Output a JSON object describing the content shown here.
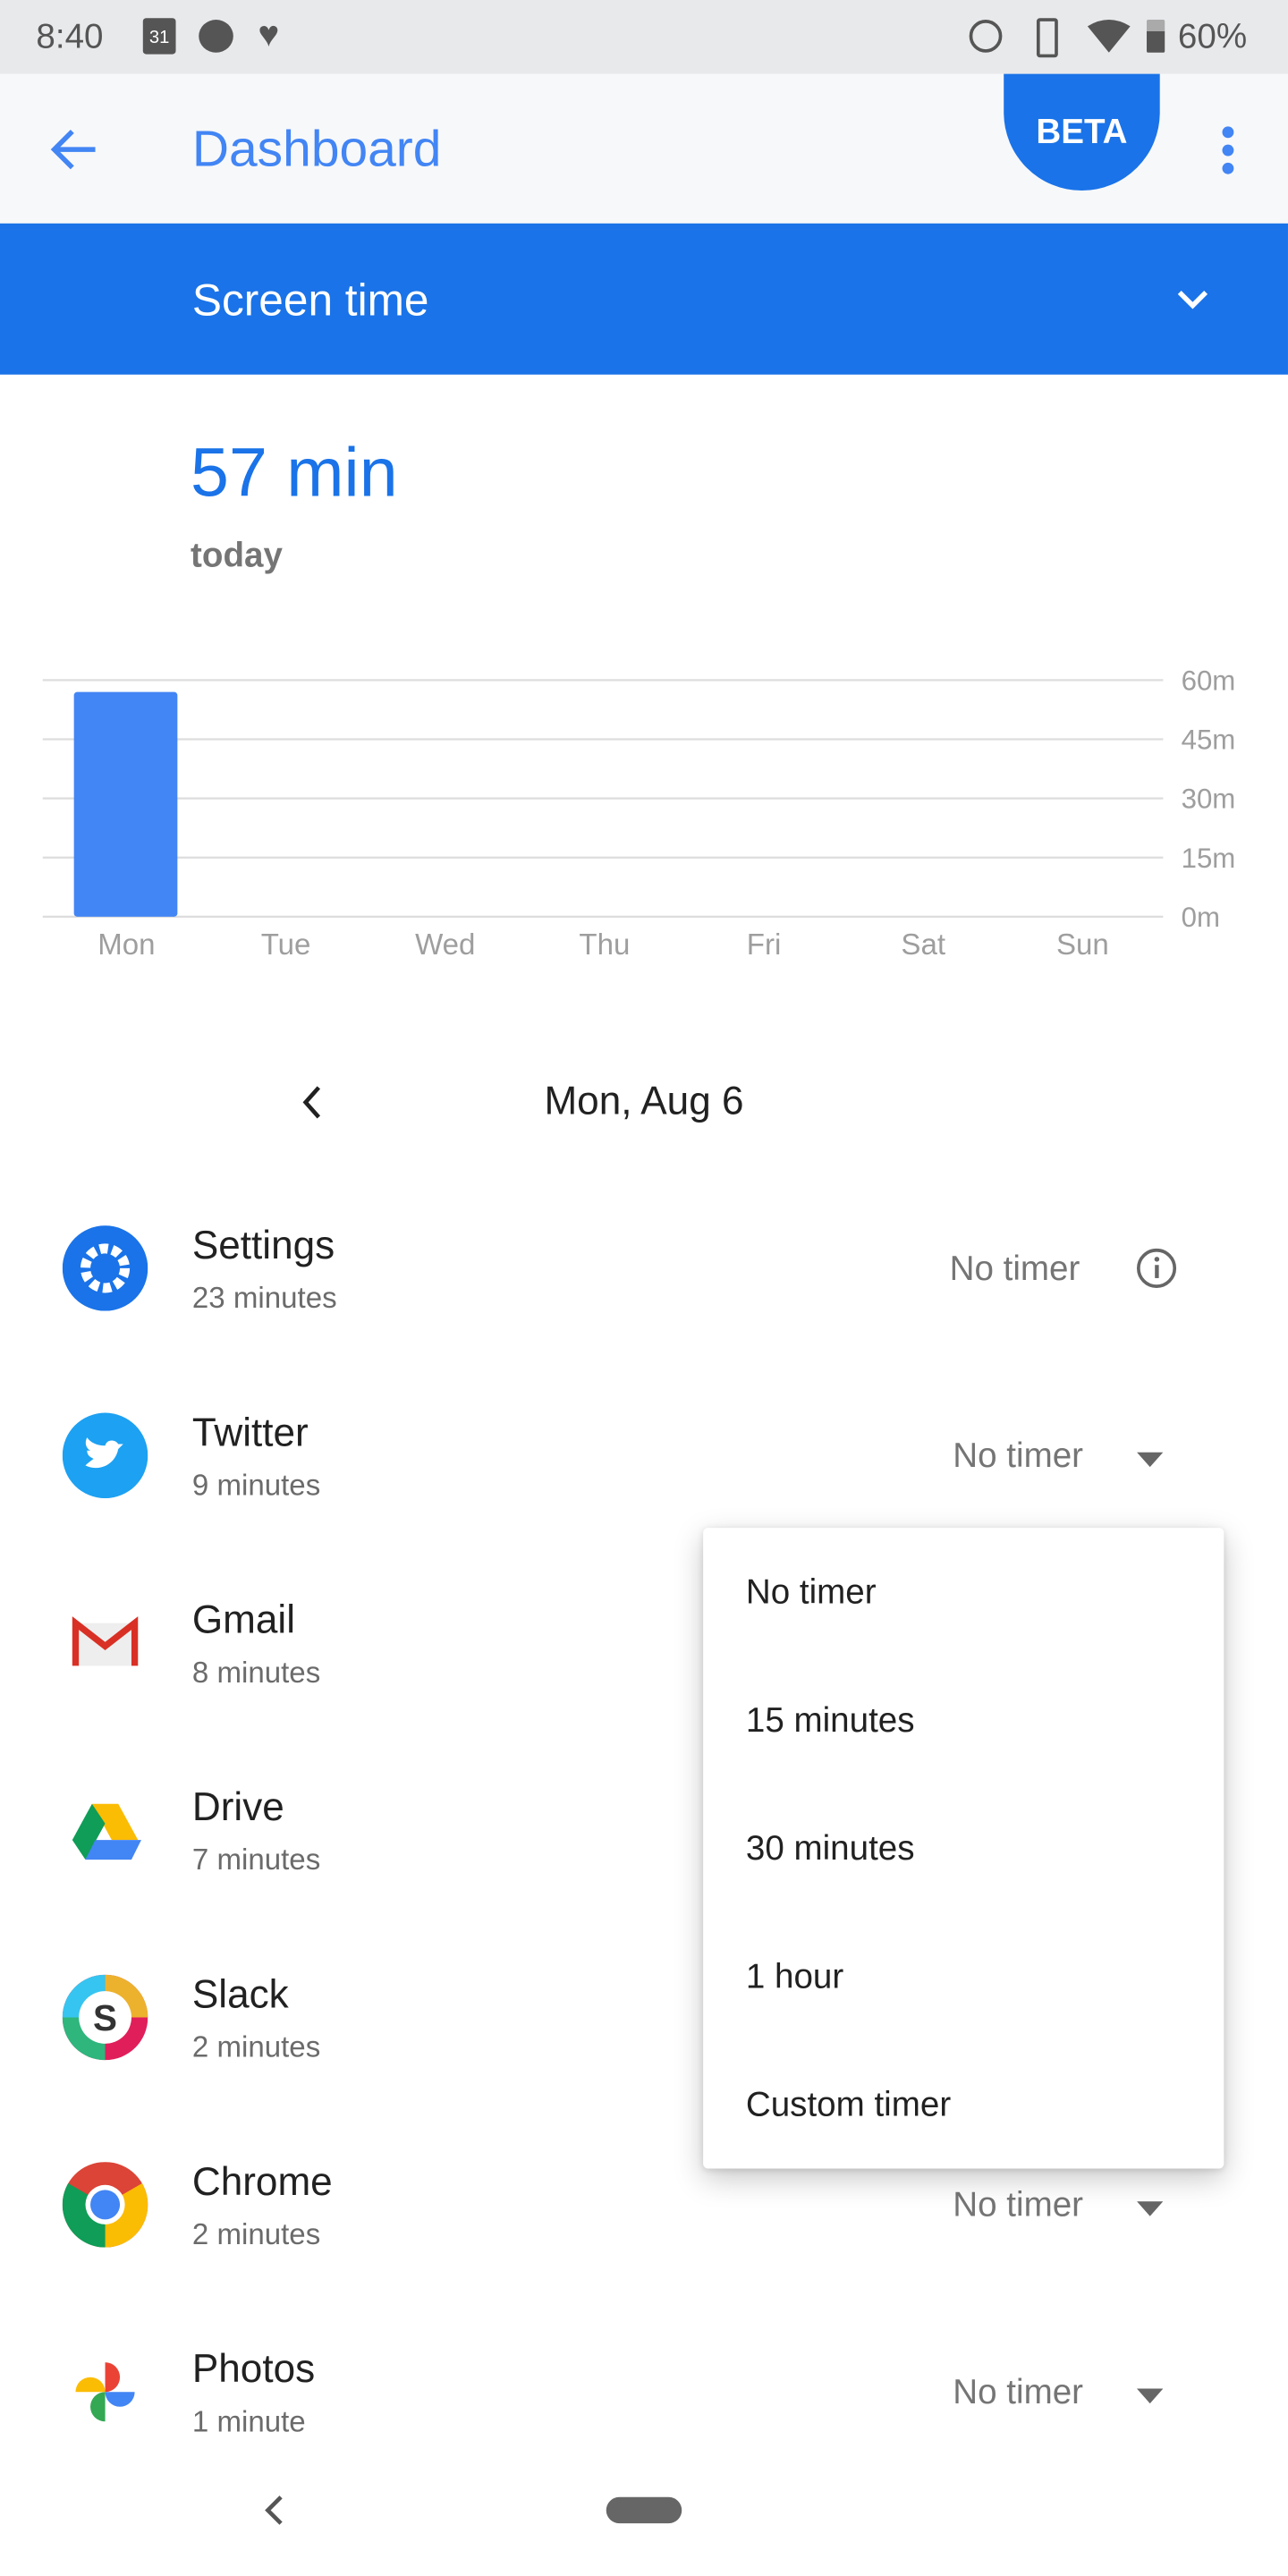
{
  "status_bar": {
    "time": "8:40",
    "battery": "60%",
    "calendar_day": "31",
    "icons": [
      "calendar-icon",
      "messenger-icon",
      "heart-icon",
      "alarm-icon",
      "vibrate-icon",
      "wifi-icon",
      "battery-icon"
    ]
  },
  "app_bar": {
    "title": "Dashboard",
    "badge": "BETA"
  },
  "section": {
    "title": "Screen time"
  },
  "summary": {
    "value": "57 min",
    "label": "today"
  },
  "chart_data": {
    "type": "bar",
    "categories": [
      "Mon",
      "Tue",
      "Wed",
      "Thu",
      "Fri",
      "Sat",
      "Sun"
    ],
    "values": [
      57,
      0,
      0,
      0,
      0,
      0,
      0
    ],
    "ylim": [
      0,
      60
    ],
    "yticks": [
      "0m",
      "15m",
      "30m",
      "45m",
      "60m"
    ],
    "ytick_values": [
      0,
      15,
      30,
      45,
      60
    ],
    "grid": true,
    "bar_color": "#4285f4"
  },
  "date_nav": {
    "date": "Mon, Aug 6"
  },
  "apps": [
    {
      "name": "Settings",
      "usage": "23 minutes",
      "timer": "No timer",
      "icon": "settings-icon"
    },
    {
      "name": "Twitter",
      "usage": "9 minutes",
      "timer": "No timer",
      "icon": "twitter-icon"
    },
    {
      "name": "Gmail",
      "usage": "8 minutes",
      "icon": "gmail-icon"
    },
    {
      "name": "Drive",
      "usage": "7 minutes",
      "icon": "drive-icon"
    },
    {
      "name": "Slack",
      "usage": "2 minutes",
      "icon": "slack-icon"
    },
    {
      "name": "Chrome",
      "usage": "2 minutes",
      "timer": "No timer",
      "icon": "chrome-icon"
    },
    {
      "name": "Photos",
      "usage": "1 minute",
      "timer": "No timer",
      "icon": "photos-icon"
    }
  ],
  "timer_menu": {
    "options": [
      "No timer",
      "15 minutes",
      "30 minutes",
      "1 hour",
      "Custom timer"
    ]
  },
  "colors": {
    "accent": "#1a73e8",
    "bar": "#4285f4"
  }
}
